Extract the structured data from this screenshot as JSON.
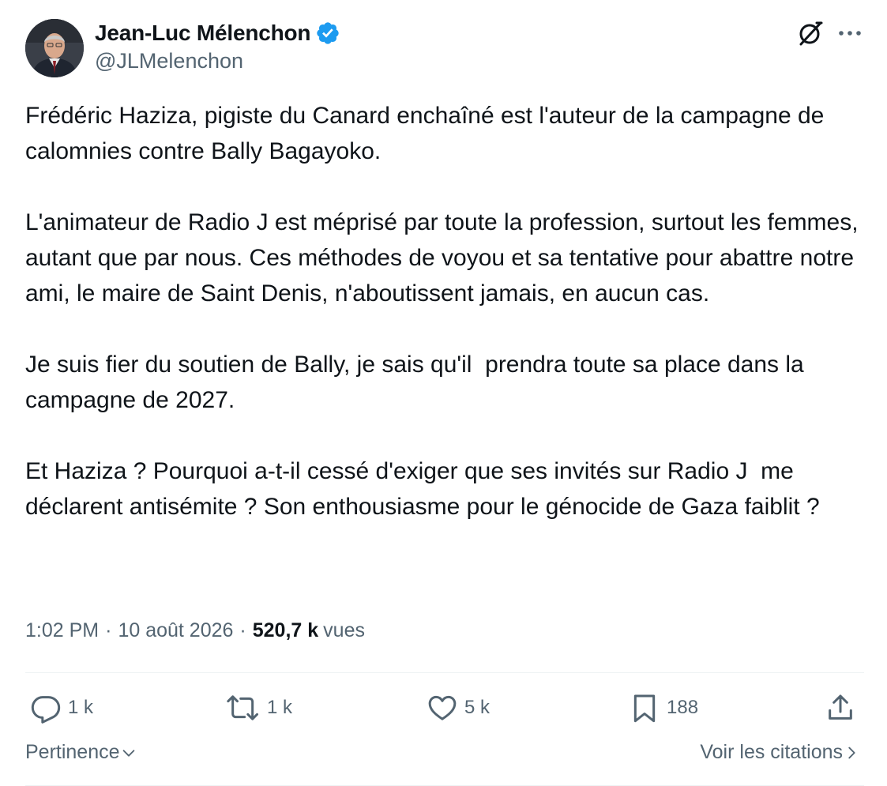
{
  "author": {
    "display_name": "Jean-Luc Mélenchon",
    "handle": "@JLMelenchon",
    "verified": true,
    "verified_color": "#1d9bf0"
  },
  "tweet": {
    "paragraphs": [
      "Frédéric Haziza, pigiste du Canard enchaîné est l'auteur de la campagne de calomnies contre Bally Bagayoko.",
      "L'animateur de Radio J est méprisé par toute la profession, surtout les femmes, autant que par nous. Ces méthodes de voyou et sa tentative pour abattre notre ami, le maire de Saint Denis, n'aboutissent jamais, en aucun cas.",
      "Je suis fier du soutien de Bally, je sais qu'il  prendra toute sa place dans la campagne de 2027.",
      "Et Haziza ? Pourquoi a-t-il cessé d'exiger que ses invités sur Radio J  me déclarent antisémite ? Son enthousiasme pour le génocide de Gaza faiblit ?"
    ]
  },
  "meta": {
    "time": "1:02 PM",
    "separator": "·",
    "date": "10 août 2026",
    "views_count": "520,7 k",
    "views_label": "vues"
  },
  "actions": {
    "reply_count": "1 k",
    "retweet_count": "1 k",
    "like_count": "5 k",
    "bookmark_count": "188"
  },
  "footer": {
    "sort_label": "Pertinence",
    "quotes_label": "Voir les citations"
  },
  "icons": {
    "verified": "verified-badge-icon",
    "grok": "grok-icon",
    "more": "more-icon",
    "reply": "reply-icon",
    "retweet": "retweet-icon",
    "like": "heart-icon",
    "bookmark": "bookmark-icon",
    "share": "share-icon",
    "chevron_down": "chevron-down-icon",
    "chevron_right": "chevron-right-icon"
  },
  "colors": {
    "text_primary": "#0f1419",
    "text_secondary": "#536471",
    "divider": "#eff3f4",
    "accent": "#1d9bf0"
  }
}
